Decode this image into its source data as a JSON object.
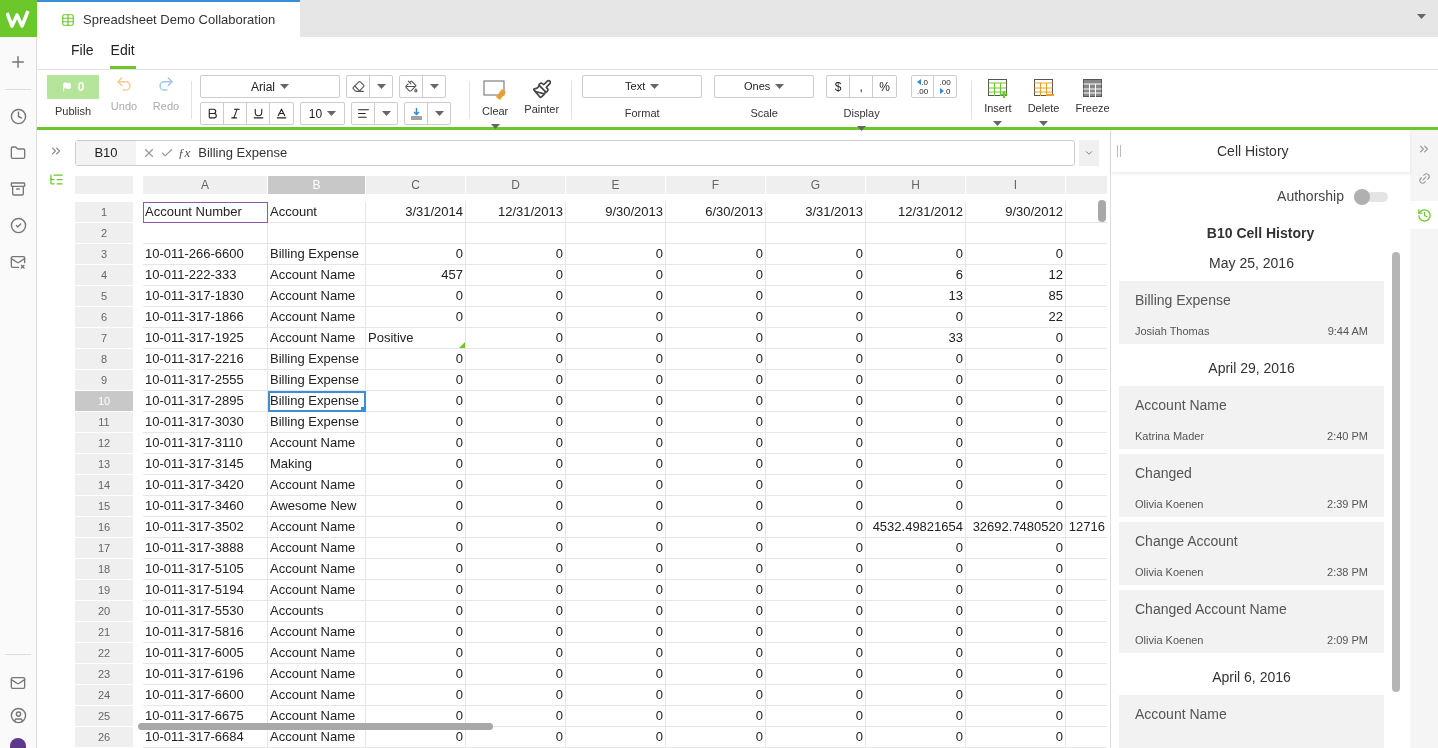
{
  "document_tab": {
    "title": "Spreadsheet Demo Collaboration"
  },
  "menu": [
    {
      "label": "File",
      "selected": false
    },
    {
      "label": "Edit",
      "selected": true
    }
  ],
  "toolbar": {
    "publish": {
      "label": "Publish",
      "count": "0"
    },
    "undo": {
      "label": "Undo",
      "disabled": true
    },
    "redo": {
      "label": "Redo",
      "disabled": true
    },
    "font": "Arial",
    "font_size": "10",
    "clear": "Clear",
    "painter": "Painter",
    "format": {
      "value": "Text",
      "label": "Format"
    },
    "scale": {
      "value": "Ones",
      "label": "Scale"
    },
    "display": {
      "label": "Display",
      "symbols": [
        "$",
        ",",
        "%"
      ]
    },
    "decimals": [
      {
        "top": ".0",
        "bottom": ".00"
      },
      {
        "top": ".00",
        "bottom": ".0"
      }
    ],
    "insert": "Insert",
    "delete": "Delete",
    "freeze": "Freeze"
  },
  "formula_bar": {
    "cell": "B10",
    "function_symbol": "ƒx",
    "value": "Billing Expense"
  },
  "columns": [
    {
      "label": "A",
      "selected": false
    },
    {
      "label": "B",
      "selected": true
    },
    {
      "label": "C",
      "selected": false
    },
    {
      "label": "D",
      "selected": false
    },
    {
      "label": "E",
      "selected": false
    },
    {
      "label": "F",
      "selected": false
    },
    {
      "label": "G",
      "selected": false
    },
    {
      "label": "H",
      "selected": false
    },
    {
      "label": "I",
      "selected": false
    }
  ],
  "rows": [
    {
      "number": "1",
      "selected": false,
      "cells": [
        {
          "text": "Account Number",
          "outlined": true
        },
        "Account",
        "3/31/2014",
        "12/31/2013",
        "9/30/2013",
        "6/30/2013",
        "3/31/2013",
        "12/31/2012",
        "9/30/2012"
      ]
    },
    {
      "number": "2",
      "selected": false,
      "cells": []
    },
    {
      "number": "3",
      "selected": false,
      "cells": [
        "10-011-266-6600",
        "Billing Expense",
        "0",
        "0",
        "0",
        "0",
        "0",
        "0",
        "0"
      ]
    },
    {
      "number": "4",
      "selected": false,
      "cells": [
        "10-011-222-333",
        "Account Name",
        "457",
        "0",
        "0",
        "0",
        "0",
        "6",
        "12"
      ]
    },
    {
      "number": "5",
      "selected": false,
      "cells": [
        "10-011-317-1830",
        "Account Name",
        "0",
        "0",
        "0",
        "0",
        "0",
        "13",
        "85"
      ]
    },
    {
      "number": "6",
      "selected": false,
      "cells": [
        "10-011-317-1866",
        "Account Name",
        "0",
        "0",
        "0",
        "0",
        "0",
        "0",
        "22"
      ]
    },
    {
      "number": "7",
      "selected": false,
      "cells": [
        "10-011-317-1925",
        "Account Name",
        {
          "text": "Positive",
          "kind": "text",
          "comment": true
        },
        "0",
        "0",
        "0",
        "0",
        "33",
        "0"
      ]
    },
    {
      "number": "8",
      "selected": false,
      "cells": [
        "10-011-317-2216",
        "Billing Expense",
        "0",
        "0",
        "0",
        "0",
        "0",
        "0",
        "0"
      ]
    },
    {
      "number": "9",
      "selected": false,
      "cells": [
        "10-011-317-2555",
        "Billing Expense",
        "0",
        "0",
        "0",
        "0",
        "0",
        "0",
        "0"
      ]
    },
    {
      "number": "10",
      "selected": true,
      "cells": [
        "10-011-317-2895",
        {
          "text": "Billing Expense",
          "selected": true
        },
        "0",
        "0",
        "0",
        "0",
        "0",
        "0",
        "0"
      ]
    },
    {
      "number": "11",
      "selected": false,
      "cells": [
        "10-011-317-3030",
        "Billing Expense",
        "0",
        "0",
        "0",
        "0",
        "0",
        "0",
        "0"
      ]
    },
    {
      "number": "12",
      "selected": false,
      "cells": [
        "10-011-317-3110",
        "Account Name",
        "0",
        "0",
        "0",
        "0",
        "0",
        "0",
        "0"
      ]
    },
    {
      "number": "13",
      "selected": false,
      "cells": [
        "10-011-317-3145",
        "Making",
        "0",
        "0",
        "0",
        "0",
        "0",
        "0",
        "0"
      ]
    },
    {
      "number": "14",
      "selected": false,
      "cells": [
        "10-011-317-3420",
        "Account Name",
        "0",
        "0",
        "0",
        "0",
        "0",
        "0",
        "0"
      ]
    },
    {
      "number": "15",
      "selected": false,
      "cells": [
        "10-011-317-3460",
        "Awesome New",
        "0",
        "0",
        "0",
        "0",
        "0",
        "0",
        "0"
      ]
    },
    {
      "number": "16",
      "selected": false,
      "cells": [
        "10-011-317-3502",
        "Account Name",
        "0",
        "0",
        "0",
        "0",
        "0",
        "4532.49821654",
        "32692.7480520",
        "12716"
      ]
    },
    {
      "number": "17",
      "selected": false,
      "cells": [
        "10-011-317-3888",
        "Account Name",
        "0",
        "0",
        "0",
        "0",
        "0",
        "0",
        "0"
      ]
    },
    {
      "number": "18",
      "selected": false,
      "cells": [
        "10-011-317-5105",
        "Account Name",
        "0",
        "0",
        "0",
        "0",
        "0",
        "0",
        "0"
      ]
    },
    {
      "number": "19",
      "selected": false,
      "cells": [
        "10-011-317-5194",
        "Account Name",
        "0",
        "0",
        "0",
        "0",
        "0",
        "0",
        "0"
      ]
    },
    {
      "number": "20",
      "selected": false,
      "cells": [
        "10-011-317-5530",
        "Accounts",
        "0",
        "0",
        "0",
        "0",
        "0",
        "0",
        "0"
      ]
    },
    {
      "number": "21",
      "selected": false,
      "cells": [
        "10-011-317-5816",
        "Account Name",
        "0",
        "0",
        "0",
        "0",
        "0",
        "0",
        "0"
      ]
    },
    {
      "number": "22",
      "selected": false,
      "cells": [
        "10-011-317-6005",
        "Account Name",
        "0",
        "0",
        "0",
        "0",
        "0",
        "0",
        "0"
      ]
    },
    {
      "number": "23",
      "selected": false,
      "cells": [
        "10-011-317-6196",
        "Account Name",
        "0",
        "0",
        "0",
        "0",
        "0",
        "0",
        "0"
      ]
    },
    {
      "number": "24",
      "selected": false,
      "cells": [
        "10-011-317-6600",
        "Account Name",
        "0",
        "0",
        "0",
        "0",
        "0",
        "0",
        "0"
      ]
    },
    {
      "number": "25",
      "selected": false,
      "cells": [
        "10-011-317-6675",
        "Account Name",
        "0",
        "0",
        "0",
        "0",
        "0",
        "0",
        "0"
      ]
    },
    {
      "number": "26",
      "selected": false,
      "cells": [
        "10-011-317-6684",
        "Account Name",
        "0",
        "0",
        "0",
        "0",
        "0",
        "0",
        "0"
      ]
    }
  ],
  "history_panel": {
    "title": "Cell History",
    "authorship": {
      "label": "Authorship",
      "on": false
    },
    "heading": "B10 Cell History",
    "groups": [
      {
        "date": "May 25, 2016",
        "entries": [
          {
            "value": "Billing Expense",
            "author": "Josiah Thomas",
            "time": "9:44 AM"
          }
        ]
      },
      {
        "date": "April 29, 2016",
        "entries": [
          {
            "value": "Account Name",
            "author": "Katrina Mader",
            "time": "2:40 PM"
          },
          {
            "value": "Changed",
            "author": "Olivia Koenen",
            "time": "2:39 PM"
          },
          {
            "value": "Change Account",
            "author": "Olivia Koenen",
            "time": "2:38 PM"
          },
          {
            "value": "Changed Account Name",
            "author": "Olivia Koenen",
            "time": "2:09 PM"
          }
        ]
      },
      {
        "date": "April 6, 2016",
        "entries": [
          {
            "value": "Account Name"
          }
        ]
      }
    ]
  }
}
